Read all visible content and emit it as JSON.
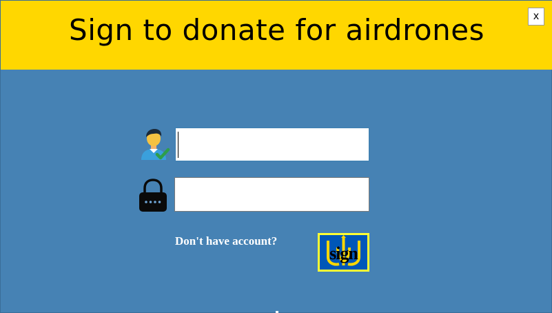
{
  "window": {
    "title": "Sign to donate for airdrones",
    "close_label": "x"
  },
  "form": {
    "username": {
      "icon": "user-check-icon",
      "value": "",
      "placeholder": ""
    },
    "password": {
      "icon": "lock-icon",
      "value": "",
      "placeholder": ""
    },
    "signup_link": "Don't have account?",
    "submit_label": "sign",
    "submit_icon": "trident-emblem"
  },
  "colors": {
    "background": "#4682b4",
    "header": "#ffd700",
    "button_border": "#ffff33",
    "button_fill": "#0057b8"
  }
}
